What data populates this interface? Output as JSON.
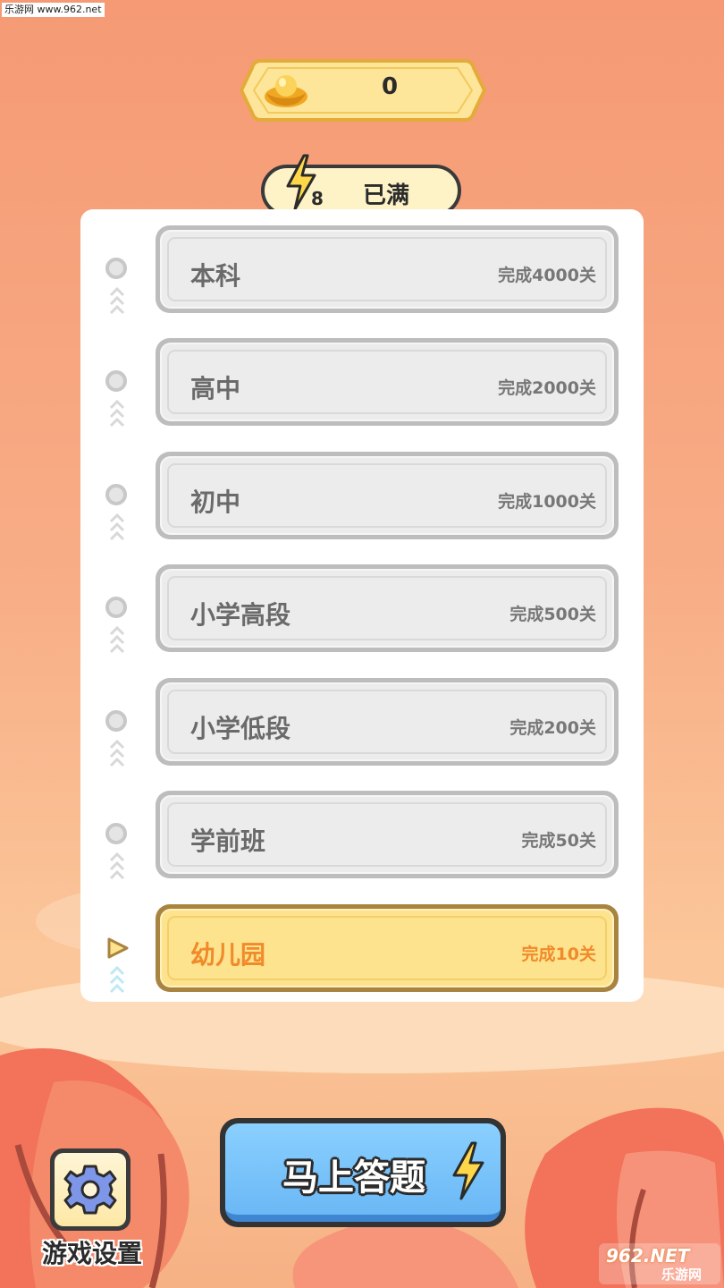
{
  "watermark_top": "乐游网 www.962.net",
  "coins": {
    "value": "0",
    "icon": "gold-ingot-icon"
  },
  "energy": {
    "count": "8",
    "status": "已满",
    "icon": "lightning-icon"
  },
  "levels": [
    {
      "name": "本科",
      "requirement": "完成4000关",
      "state": "locked"
    },
    {
      "name": "高中",
      "requirement": "完成2000关",
      "state": "locked"
    },
    {
      "name": "初中",
      "requirement": "完成1000关",
      "state": "locked"
    },
    {
      "name": "小学高段",
      "requirement": "完成500关",
      "state": "locked"
    },
    {
      "name": "小学低段",
      "requirement": "完成200关",
      "state": "locked"
    },
    {
      "name": "学前班",
      "requirement": "完成50关",
      "state": "locked"
    },
    {
      "name": "幼儿园",
      "requirement": "完成10关",
      "state": "current"
    }
  ],
  "settings": {
    "label": "游戏设置",
    "icon": "gear-icon"
  },
  "answer_button": {
    "label": "马上答题",
    "icon": "lightning-icon"
  },
  "watermark_bottom": {
    "brand": "962.NET",
    "name": "乐游网"
  },
  "colors": {
    "background": "#f8ad86",
    "active_card": "#fde38d",
    "active_text": "#f08a2a",
    "locked_card": "#ececec",
    "answer_button": "#7cc4fb"
  }
}
